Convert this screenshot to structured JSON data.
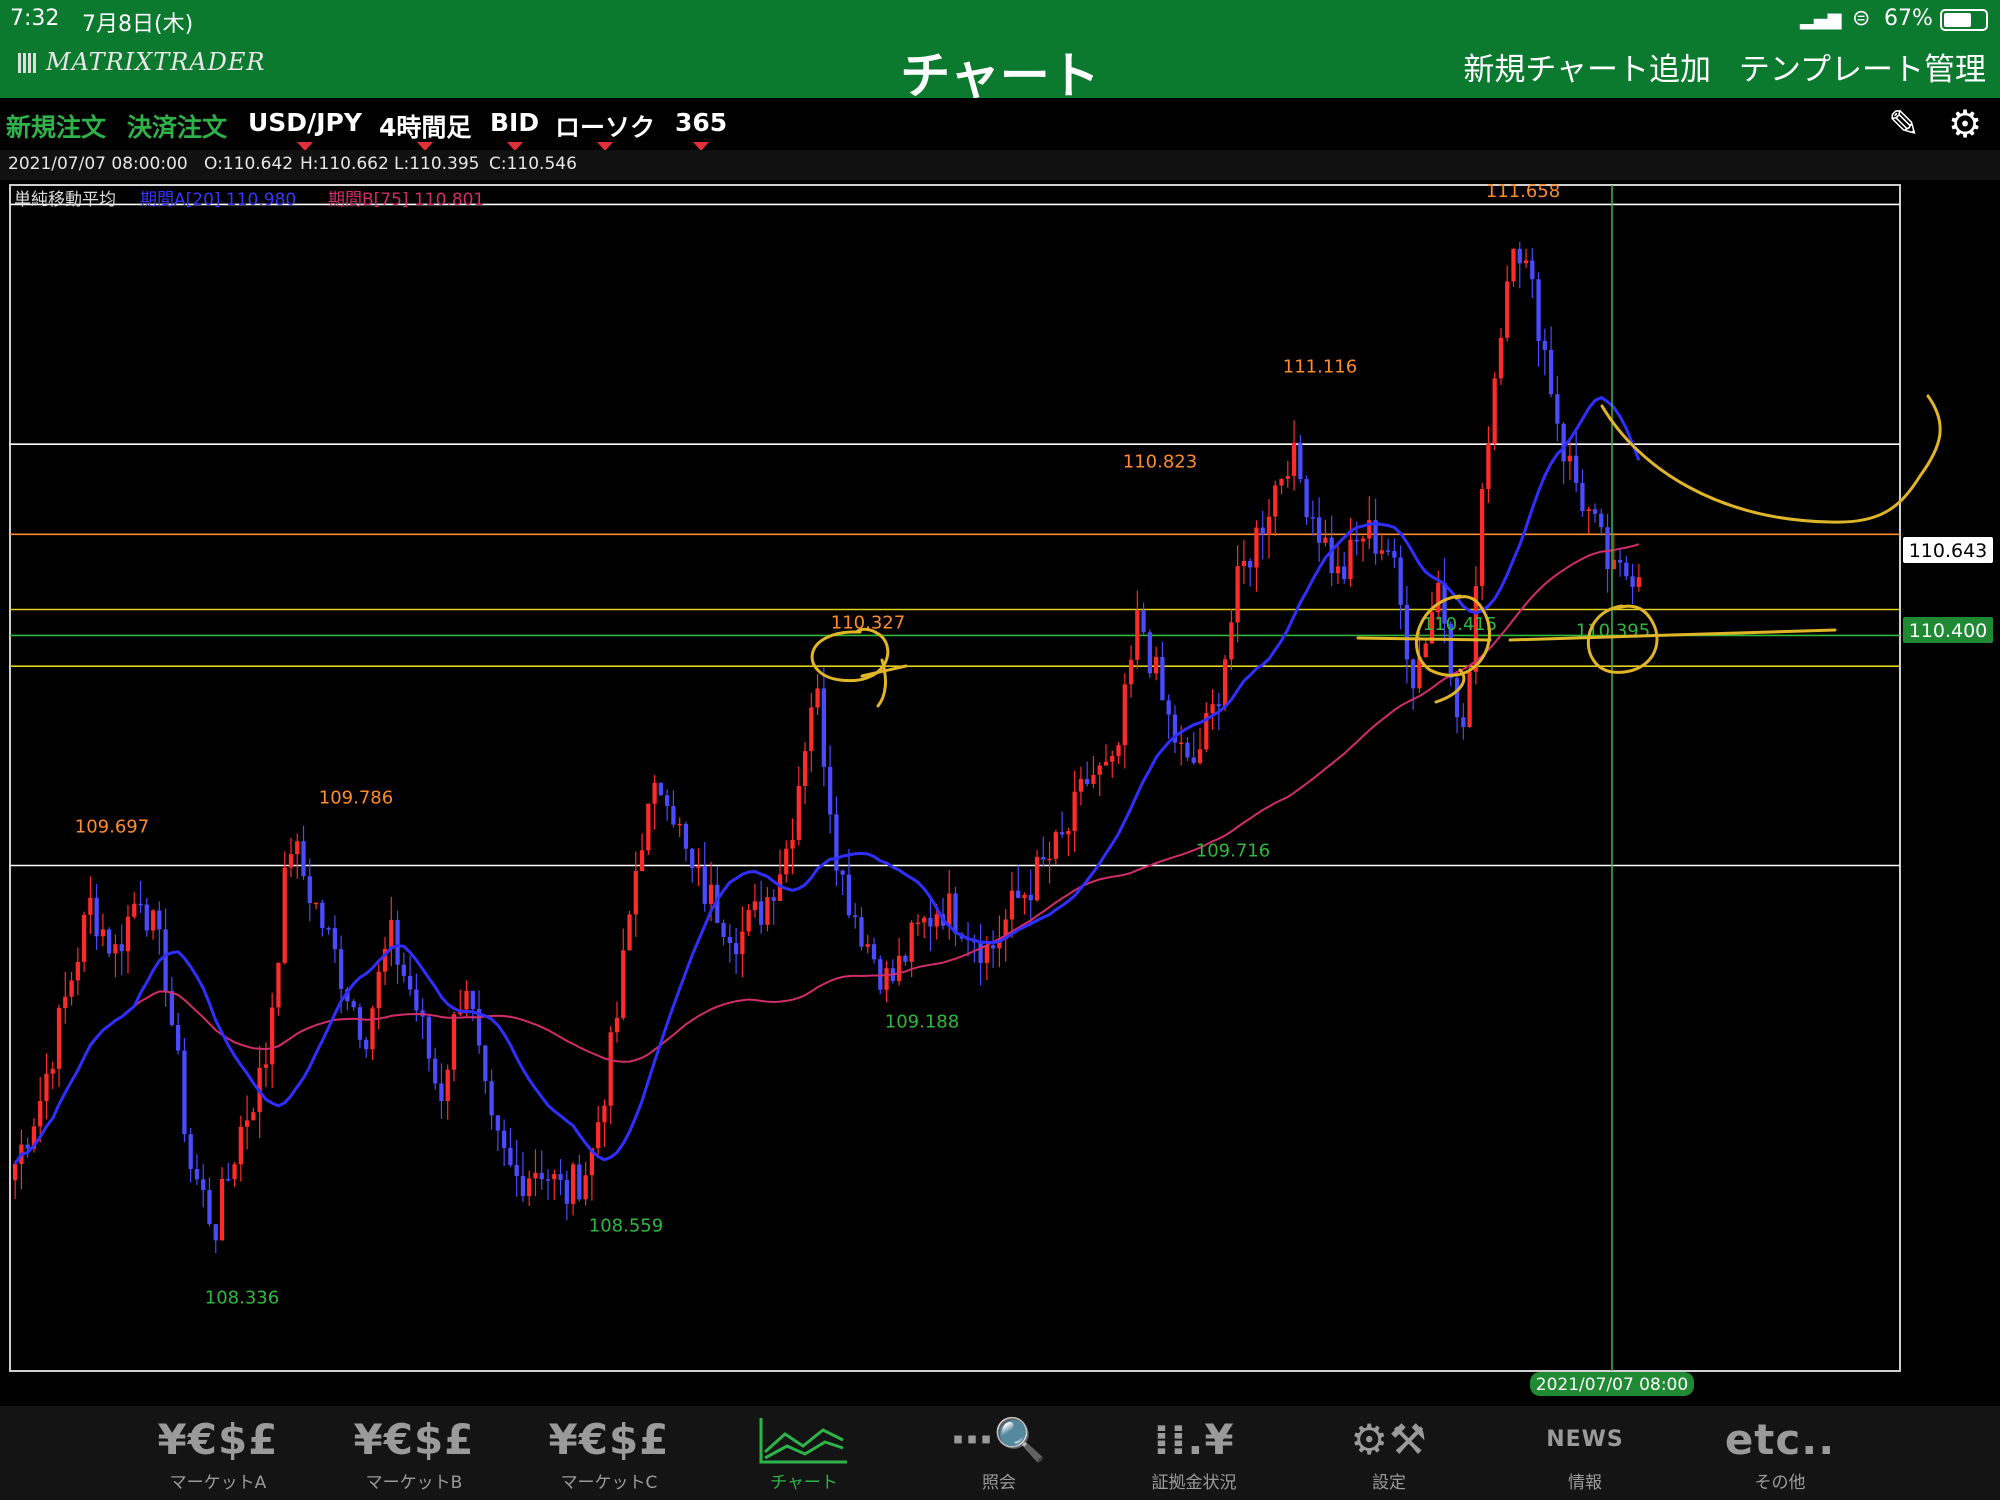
{
  "status": {
    "time": "7:32",
    "date": "7月8日(木)",
    "battery": "67%"
  },
  "header": {
    "logo": "MATRIXTRADER",
    "title": "チャート",
    "add_chart": "新規チャート追加",
    "template": "テンプレート管理"
  },
  "toolbar": {
    "new_order": "新規注文",
    "close_order": "決済注文",
    "pair": "USD/JPY",
    "timeframe": "4時間足",
    "side": "BID",
    "chart_kind": "ローソク",
    "course": "365",
    "pencil_icon": "pencil-icon",
    "gear_icon": "gear-icon"
  },
  "info": {
    "datetime": "2021/07/07 08:00:00",
    "open": "O:110.642",
    "high": "H:110.662",
    "low": "L:110.395",
    "close": "C:110.546"
  },
  "indicator": {
    "name": "単純移動平均",
    "ma_a": "期間A[20] 110.980",
    "ma_b": "期間B[75] 110.801"
  },
  "price_tags": {
    "current": "110.643",
    "line": "110.400"
  },
  "crosshair_time": "2021/07/07 08:00",
  "colors": {
    "header": "#0b7a2f",
    "bull": "#ff2a2a",
    "bear": "#4a4aff",
    "ma_a": "#2f2fff",
    "ma_b": "#d02d6a",
    "high_label": "#ff8c2a",
    "low_label": "#2eb83c",
    "annotation": "#e0b528"
  },
  "chart_data": {
    "type": "candlestick",
    "ylim": [
      108.06,
      111.72
    ],
    "annotated_highs": [
      "109.697",
      "109.786",
      "110.327",
      "110.823",
      "111.116",
      "111.658"
    ],
    "annotated_lows": [
      "108.336",
      "108.559",
      "109.188",
      "109.716",
      "110.415",
      "110.395"
    ],
    "horizontal_lines": [
      111.66,
      110.92,
      110.4,
      110.3,
      110.4,
      110.26,
      109.62
    ],
    "close_path": [
      108.7,
      108.9,
      109.2,
      109.5,
      109.35,
      109.55,
      109.3,
      108.7,
      108.5,
      108.8,
      109.0,
      109.7,
      109.5,
      109.3,
      109.1,
      109.4,
      109.2,
      108.9,
      109.3,
      108.8,
      108.65,
      108.7,
      108.6,
      108.7,
      109.1,
      109.7,
      109.9,
      109.6,
      109.5,
      109.4,
      109.5,
      109.7,
      110.2,
      109.6,
      109.4,
      109.25,
      109.4,
      109.5,
      109.45,
      109.35,
      109.5,
      109.6,
      109.7,
      109.9,
      109.9,
      110.4,
      110.1,
      109.9,
      110.1,
      110.5,
      110.7,
      110.9,
      110.7,
      110.5,
      110.65,
      110.6,
      110.2,
      110.5,
      110.0,
      111.0,
      111.6,
      111.3,
      110.9,
      110.7,
      110.5,
      110.55
    ]
  }
}
